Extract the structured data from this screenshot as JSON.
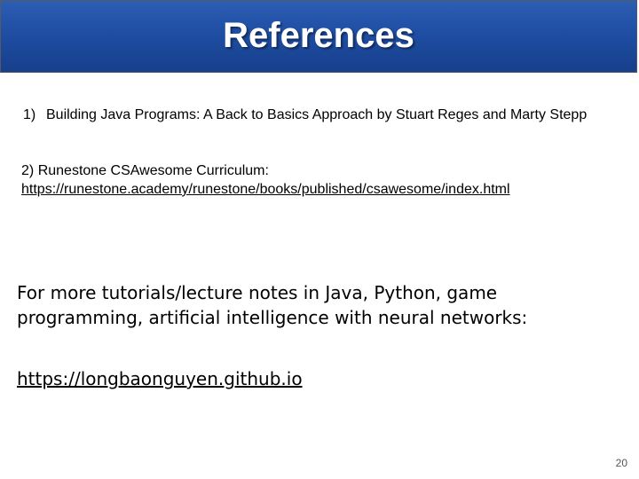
{
  "slide": {
    "title": "References",
    "references": [
      {
        "number": "1)",
        "text": "Building Java Programs: A Back to Basics Approach by Stuart Reges and Marty Stepp"
      },
      {
        "number": "2)",
        "text": "Runestone CSAwesome Curriculum:",
        "link": "https://runestone.academy/runestone/books/published/csawesome/index.html"
      }
    ],
    "more_text": "For more tutorials/lecture notes in Java, Python, game programming, artificial intelligence with neural networks:",
    "site_link": "https://longbaonguyen.github.io",
    "page_number": "20"
  },
  "colors": {
    "banner": "#1f4ea3",
    "title_text": "#ffffff",
    "body_text": "#000000"
  }
}
